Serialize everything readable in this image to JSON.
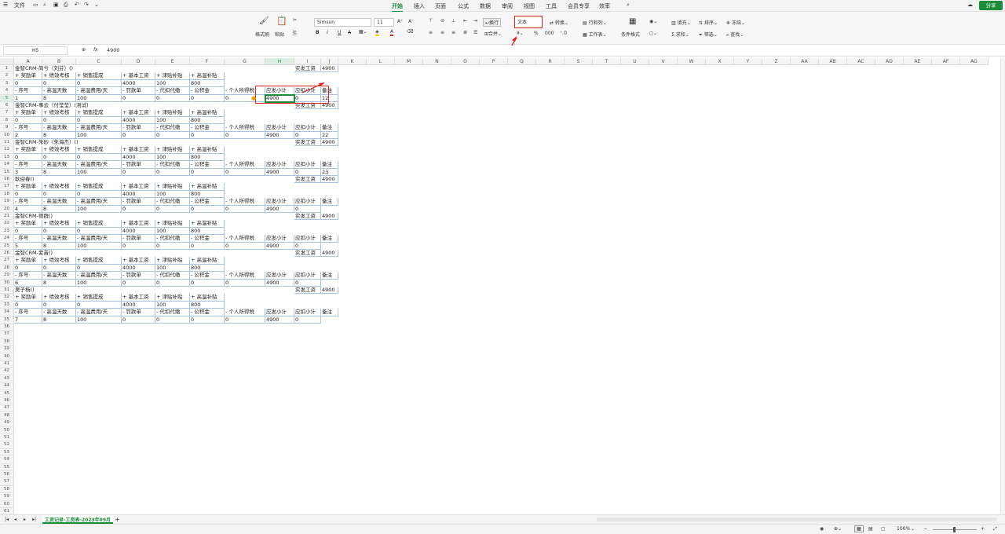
{
  "titlebar": {
    "file_menu": "文件",
    "tabs": [
      "开始",
      "插入",
      "页面",
      "公式",
      "数据",
      "审阅",
      "视图",
      "工具",
      "会员专享",
      "效率"
    ],
    "active_tab": "开始",
    "share_label": "分享"
  },
  "ribbon": {
    "format_painter": "格式刷",
    "paste": "粘贴",
    "font_name": "Simsun",
    "font_size": "11",
    "wrap": "换行",
    "merge": "合并",
    "number_format": "文本",
    "convert": "转换",
    "rows_cols": "行和列",
    "worksheet": "工作表",
    "cond_format": "条件格式",
    "fill": "填充",
    "sort": "排序",
    "freeze": "冻结",
    "sum": "求和",
    "filter": "筛选",
    "find": "查找",
    "bold": "B",
    "italic": "I",
    "underline": "U",
    "strike": "A",
    "brand_green": "#1a8c3a",
    "highlight_red": "#e02020"
  },
  "formulabar": {
    "name_box": "H5",
    "fx": "fx",
    "value": "4900"
  },
  "columns": [
    "A",
    "B",
    "C",
    "D",
    "E",
    "F",
    "G",
    "H",
    "I",
    "J",
    "K",
    "L",
    "M",
    "N",
    "O",
    "P",
    "Q",
    "R",
    "S",
    "T",
    "U",
    "V",
    "W",
    "X",
    "Y",
    "Z",
    "AA",
    "AB",
    "AC",
    "AD",
    "AE",
    "AF",
    "AG"
  ],
  "rows": [
    {
      "n": "1",
      "cells": {
        "A": "金智CRM-简兮（刘芬）()",
        "I": "实发工资",
        "J": "4900"
      }
    },
    {
      "n": "2",
      "cells": {
        "A": "+ 奖励单",
        "B": "+ 绩效考核",
        "C": "+ 销售提成",
        "D": "+ 基本工资",
        "E": "+ 津贴补贴",
        "F": "+ 高温补贴"
      }
    },
    {
      "n": "3",
      "cells": {
        "A": "0",
        "B": "0",
        "C": "0",
        "D": "4000",
        "E": "100",
        "F": "800"
      }
    },
    {
      "n": "4",
      "cells": {
        "A": "- 序号",
        "B": "- 高温天数",
        "C": "- 高温费用/天",
        "D": "- 罚款单",
        "E": "- 代扣代缴",
        "F": "- 公积金",
        "G": "- 个人所得税",
        "H": "应发小计",
        "I": "应扣小计",
        "J": "备注"
      }
    },
    {
      "n": "5",
      "cells": {
        "A": "1",
        "B": "8",
        "C": "100",
        "D": "0",
        "E": "0",
        "F": "0",
        "G": "0",
        "H": "4900",
        "I": "0",
        "J": "12"
      }
    },
    {
      "n": "6",
      "cells": {
        "A": "金智CRM-事云（付莹莹）(测试)",
        "I": "实发工资",
        "J": "4900"
      }
    },
    {
      "n": "7",
      "cells": {
        "A": "+ 奖励单",
        "B": "+ 绩效考核",
        "C": "+ 销售提成",
        "D": "+ 基本工资",
        "E": "+ 津贴补贴",
        "F": "+ 高温补贴"
      }
    },
    {
      "n": "8",
      "cells": {
        "A": "0",
        "B": "0",
        "C": "0",
        "D": "4000",
        "E": "100",
        "F": "800"
      }
    },
    {
      "n": "9",
      "cells": {
        "A": "- 序号",
        "B": "- 高温天数",
        "C": "- 高温费用/天",
        "D": "- 罚款单",
        "E": "- 代扣代缴",
        "F": "- 公积金",
        "G": "- 个人所得税",
        "H": "应发小计",
        "I": "应扣小计",
        "J": "备注"
      }
    },
    {
      "n": "10",
      "cells": {
        "A": "2",
        "B": "8",
        "C": "100",
        "D": "0",
        "E": "0",
        "F": "0",
        "G": "0",
        "H": "4900",
        "I": "0",
        "J": "22"
      }
    },
    {
      "n": "11",
      "cells": {
        "A": "金智CRM-朱砂（朱海杰）()",
        "I": "实发工资",
        "J": "4900"
      }
    },
    {
      "n": "12",
      "cells": {
        "A": "+ 奖励单",
        "B": "+ 绩效考核",
        "C": "+ 销售提成",
        "D": "+ 基本工资",
        "E": "+ 津贴补贴",
        "F": "+ 高温补贴"
      }
    },
    {
      "n": "13",
      "cells": {
        "A": "0",
        "B": "0",
        "C": "0",
        "D": "4000",
        "E": "100",
        "F": "800"
      }
    },
    {
      "n": "14",
      "cells": {
        "A": "- 序号",
        "B": "- 高温天数",
        "C": "- 高温费用/天",
        "D": "- 罚款单",
        "E": "- 代扣代缴",
        "F": "- 公积金",
        "G": "- 个人所得税",
        "H": "应发小计",
        "I": "应扣小计",
        "J": "备注"
      }
    },
    {
      "n": "15",
      "cells": {
        "A": "3",
        "B": "8",
        "C": "100",
        "D": "0",
        "E": "0",
        "F": "0",
        "G": "0",
        "H": "4900",
        "I": "0",
        "J": "23"
      }
    },
    {
      "n": "16",
      "cells": {
        "A": "耿迎春()",
        "I": "实发工资",
        "J": "4900"
      }
    },
    {
      "n": "17",
      "cells": {
        "A": "+ 奖励单",
        "B": "+ 绩效考核",
        "C": "+ 销售提成",
        "D": "+ 基本工资",
        "E": "+ 津贴补贴",
        "F": "+ 高温补贴"
      }
    },
    {
      "n": "18",
      "cells": {
        "A": "0",
        "B": "0",
        "C": "0",
        "D": "4000",
        "E": "100",
        "F": "800"
      }
    },
    {
      "n": "19",
      "cells": {
        "A": "- 序号",
        "B": "- 高温天数",
        "C": "- 高温费用/天",
        "D": "- 罚款单",
        "E": "- 代扣代缴",
        "F": "- 公积金",
        "G": "- 个人所得税",
        "H": "应发小计",
        "I": "应扣小计",
        "J": "备注"
      }
    },
    {
      "n": "20",
      "cells": {
        "A": "4",
        "B": "8",
        "C": "100",
        "D": "0",
        "E": "0",
        "F": "0",
        "G": "0",
        "H": "4900",
        "I": "0"
      }
    },
    {
      "n": "21",
      "cells": {
        "A": "金智CRM-德群()",
        "I": "实发工资",
        "J": "4900"
      }
    },
    {
      "n": "22",
      "cells": {
        "A": "+ 奖励单",
        "B": "+ 绩效考核",
        "C": "+ 销售提成",
        "D": "+ 基本工资",
        "E": "+ 津贴补贴",
        "F": "+ 高温补贴"
      }
    },
    {
      "n": "23",
      "cells": {
        "A": "0",
        "B": "0",
        "C": "0",
        "D": "4000",
        "E": "100",
        "F": "800"
      }
    },
    {
      "n": "24",
      "cells": {
        "A": "- 序号",
        "B": "- 高温天数",
        "C": "- 高温费用/天",
        "D": "- 罚款单",
        "E": "- 代扣代缴",
        "F": "- 公积金",
        "G": "- 个人所得税",
        "H": "应发小计",
        "I": "应扣小计",
        "J": "备注"
      }
    },
    {
      "n": "25",
      "cells": {
        "A": "5",
        "B": "8",
        "C": "100",
        "D": "0",
        "E": "0",
        "F": "0",
        "G": "0",
        "H": "4900",
        "I": "0"
      }
    },
    {
      "n": "26",
      "cells": {
        "A": "金智CRM-紫苗()",
        "I": "实发工资",
        "J": "4900"
      }
    },
    {
      "n": "27",
      "cells": {
        "A": "+ 奖励单",
        "B": "+ 绩效考核",
        "C": "+ 销售提成",
        "D": "+ 基本工资",
        "E": "+ 津贴补贴",
        "F": "+ 高温补贴"
      }
    },
    {
      "n": "28",
      "cells": {
        "A": "0",
        "B": "0",
        "C": "0",
        "D": "4000",
        "E": "100",
        "F": "800"
      }
    },
    {
      "n": "29",
      "cells": {
        "A": "- 序号",
        "B": "- 高温天数",
        "C": "- 高温费用/天",
        "D": "- 罚款单",
        "E": "- 代扣代缴",
        "F": "- 公积金",
        "G": "- 个人所得税",
        "H": "应发小计",
        "I": "应扣小计",
        "J": "备注"
      }
    },
    {
      "n": "30",
      "cells": {
        "A": "6",
        "B": "8",
        "C": "100",
        "D": "0",
        "E": "0",
        "F": "0",
        "G": "0",
        "H": "4900",
        "I": "0"
      }
    },
    {
      "n": "31",
      "cells": {
        "A": "吴子杨()",
        "I": "实发工资",
        "J": "4900"
      }
    },
    {
      "n": "32",
      "cells": {
        "A": "+ 奖励单",
        "B": "+ 绩效考核",
        "C": "+ 销售提成",
        "D": "+ 基本工资",
        "E": "+ 津贴补贴",
        "F": "+ 高温补贴"
      }
    },
    {
      "n": "33",
      "cells": {
        "A": "0",
        "B": "0",
        "C": "0",
        "D": "4000",
        "E": "100",
        "F": "800"
      }
    },
    {
      "n": "34",
      "cells": {
        "A": "- 序号",
        "B": "- 高温天数",
        "C": "- 高温费用/天",
        "D": "- 罚款单",
        "E": "- 代扣代缴",
        "F": "- 公积金",
        "G": "- 个人所得税",
        "H": "应发小计",
        "I": "应扣小计",
        "J": "备注"
      }
    },
    {
      "n": "35",
      "cells": {
        "A": "7",
        "B": "8",
        "C": "100",
        "D": "0",
        "E": "0",
        "F": "0",
        "G": "0",
        "H": "4900",
        "I": "0"
      }
    }
  ],
  "empty_row_count": 26,
  "sheet": {
    "tab_name": "工资记录-工资表-2023年09月",
    "add": "+"
  },
  "status": {
    "zoom": "100%"
  }
}
